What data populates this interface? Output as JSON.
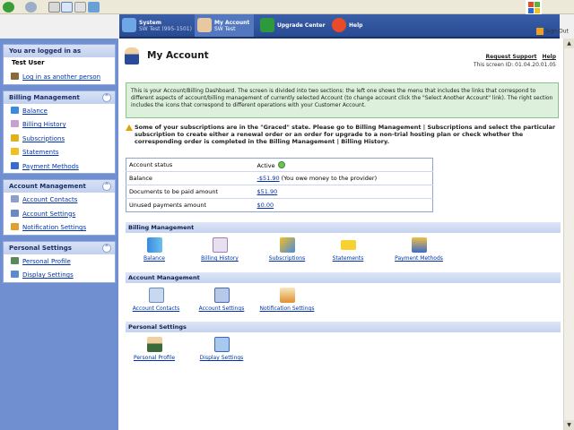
{
  "topnav": {
    "tabs": [
      {
        "title": "System",
        "sub": "SW Test (995-1501)"
      },
      {
        "title": "My Account",
        "sub": "SW Test"
      },
      {
        "title": "Upgrade Center",
        "sub": ""
      },
      {
        "title": "Help",
        "sub": ""
      }
    ],
    "sign_out": "Sign Out"
  },
  "sidebar": {
    "login": {
      "header": "You are logged in as",
      "user": "Test User",
      "link": "Log in as another person"
    },
    "sections": [
      {
        "title": "Billing Management",
        "items": [
          "Balance",
          "Billing History",
          "Subscriptions",
          "Statements",
          "Payment Methods"
        ]
      },
      {
        "title": "Account Management",
        "items": [
          "Account Contacts",
          "Account Settings",
          "Notification Settings"
        ]
      },
      {
        "title": "Personal Settings",
        "items": [
          "Personal Profile",
          "Display Settings"
        ]
      }
    ]
  },
  "page": {
    "title": "My Account",
    "request_support": "Request Support",
    "help": "Help",
    "screen_id": "This screen ID: 01.04.20.01.05",
    "info": "This is your Account/Billing Dashboard. The screen is divided into two sections: the left one shows the menu that includes the links that correspond to different aspects of account/billing management of currently selected Account (to change account click the \"Select Another Account\" link). The right section includes the icons that correspond to different operations with your Customer Account.",
    "warning": "Some of your subscriptions are in the \"Graced\" state. Please go to Billing Management | Subscriptions and select the particular subscription to create either a renewal order or an order for upgrade to a non-trial hosting plan or check whether the corresponding order is completed in the Billing Management | Billing History."
  },
  "status": {
    "rows": [
      {
        "label": "Account status",
        "value": "Active",
        "note": ""
      },
      {
        "label": "Balance",
        "value": "-$51.90",
        "note": " (You owe money to the provider)"
      },
      {
        "label": "Documents to be paid amount",
        "value": "$51.90",
        "note": ""
      },
      {
        "label": "Unused payments amount",
        "value": "$0.00",
        "note": ""
      }
    ]
  },
  "sections": [
    {
      "title": "Billing Management",
      "items": [
        "Balance",
        "Billing History",
        "Subscriptions",
        "Statements",
        "Payment Methods"
      ]
    },
    {
      "title": "Account Management",
      "items": [
        "Account Contacts",
        "Account Settings",
        "Notification Settings"
      ]
    },
    {
      "title": "Personal Settings",
      "items": [
        "Personal Profile",
        "Display Settings"
      ]
    }
  ],
  "colors": {
    "nav": "#3a5fa8",
    "sidebar": "#6f8fd0",
    "info_bg": "#dcf0dc",
    "active_dot": "#6fc05a"
  }
}
